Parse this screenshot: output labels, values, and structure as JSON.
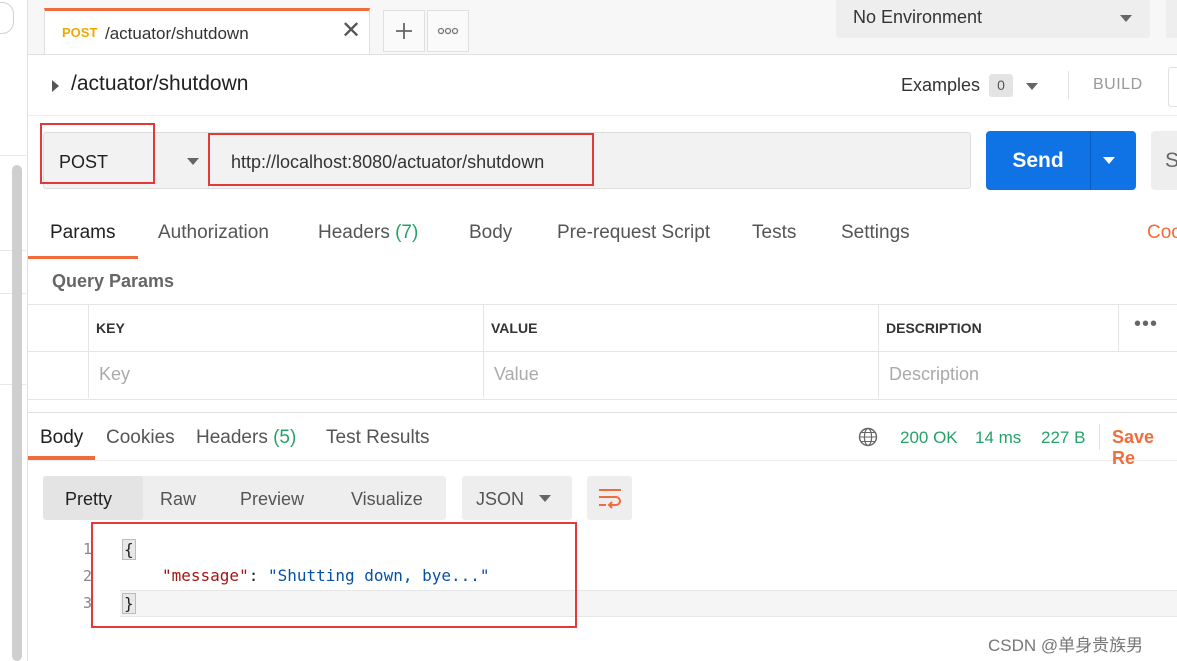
{
  "tab": {
    "method": "POST",
    "title": "/actuator/shutdown",
    "close_glyph": "✕",
    "method_color": "#f0a800"
  },
  "environment": {
    "selected": "No Environment"
  },
  "request": {
    "name": "/actuator/shutdown",
    "examples_label": "Examples",
    "examples_count": "0",
    "build_label": "BUILD",
    "method": "POST",
    "url": "http://localhost:8080/actuator/shutdown",
    "send_label": "Send",
    "save_partial": "S"
  },
  "request_tabs": {
    "params": "Params",
    "authorization": "Authorization",
    "headers": "Headers",
    "headers_count": "(7)",
    "body": "Body",
    "pre_request": "Pre-request Script",
    "tests": "Tests",
    "settings": "Settings",
    "cookies_partial": "Coo"
  },
  "query_params": {
    "title": "Query Params",
    "columns": [
      "KEY",
      "VALUE",
      "DESCRIPTION"
    ],
    "placeholders": [
      "Key",
      "Value",
      "Description"
    ],
    "more_glyph": "•••"
  },
  "response": {
    "tabs": {
      "body": "Body",
      "cookies": "Cookies",
      "headers": "Headers",
      "headers_count": "(5)",
      "test_results": "Test Results"
    },
    "status": "200 OK",
    "time": "14 ms",
    "size": "227 B",
    "save_partial": "Save Re",
    "view_modes": [
      "Pretty",
      "Raw",
      "Preview",
      "Visualize"
    ],
    "format": "JSON",
    "line_numbers": [
      "1",
      "2",
      "3"
    ],
    "code": {
      "open": "{",
      "key": "\"message\"",
      "colon": ": ",
      "value": "\"Shutting down, bye...\"",
      "close": "}"
    }
  },
  "watermark": "CSDN @单身贵族男",
  "colors": {
    "accent": "#f26b3a",
    "send": "#0f72e5",
    "success": "#26a269",
    "annotation": "#e23a3a"
  },
  "icons": [
    "plus-icon",
    "more-horizontal-icon",
    "chevron-down-icon",
    "caret-right-icon",
    "globe-icon",
    "wrap-lines-icon",
    "close-icon"
  ]
}
